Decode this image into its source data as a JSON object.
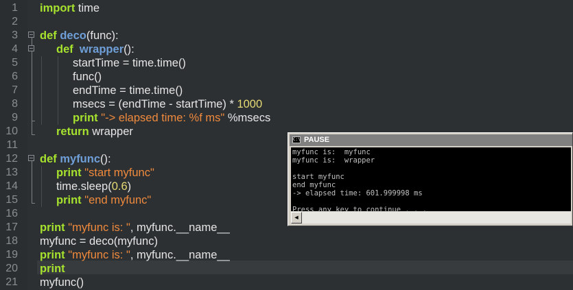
{
  "editor": {
    "line_numbers": [
      "1",
      "2",
      "3",
      "4",
      "5",
      "6",
      "7",
      "8",
      "9",
      "10",
      "11",
      "12",
      "13",
      "14",
      "15",
      "16",
      "17",
      "18",
      "19",
      "20",
      "21"
    ],
    "lines": {
      "l1": {
        "kw": "import",
        "rest": " time"
      },
      "l3": {
        "kw": "def",
        "fn": "deco",
        "rest": "(func):"
      },
      "l4": {
        "kw": "def",
        "fn": "wrapper",
        "rest": "():"
      },
      "l5": {
        "text": "startTime = time.time()"
      },
      "l6": {
        "text": "func()"
      },
      "l7": {
        "text": "endTime = time.time()"
      },
      "l8": {
        "text": "msecs = (endTime - startTime) * ",
        "num": "1000"
      },
      "l9": {
        "kw": "print",
        "str": "\"-> elapsed time: %f ms\"",
        "rest": " %msecs"
      },
      "l10": {
        "kw": "return",
        "rest": " wrapper"
      },
      "l12": {
        "kw": "def",
        "fn": "myfunc",
        "rest": "():"
      },
      "l13": {
        "kw": "print",
        "str": "\"start myfunc\""
      },
      "l14": {
        "text": "time.sleep(",
        "num": "0.6",
        "rest": ")"
      },
      "l15": {
        "kw": "print",
        "str": "\"end myfunc\""
      },
      "l17": {
        "kw": "print",
        "str": "\"myfunc is: \"",
        "rest": ", myfunc.__name__"
      },
      "l18": {
        "text": "myfunc = deco(myfunc)"
      },
      "l19": {
        "kw": "print",
        "str": "\"myfunc is: \"",
        "rest": ", myfunc.__name__"
      },
      "l20": {
        "kw": "print"
      },
      "l21": {
        "text": "myfunc()"
      }
    }
  },
  "console": {
    "title": "PAUSE",
    "icon_text": "C:\\",
    "output": [
      "myfunc is:  myfunc",
      "myfunc is:  wrapper",
      "",
      "start myfunc",
      "end myfunc",
      "-> elapsed time: 601.999998 ms",
      "",
      "Press any key to continue . . ."
    ],
    "scroll_left": "◄",
    "scroll_right": "►"
  }
}
